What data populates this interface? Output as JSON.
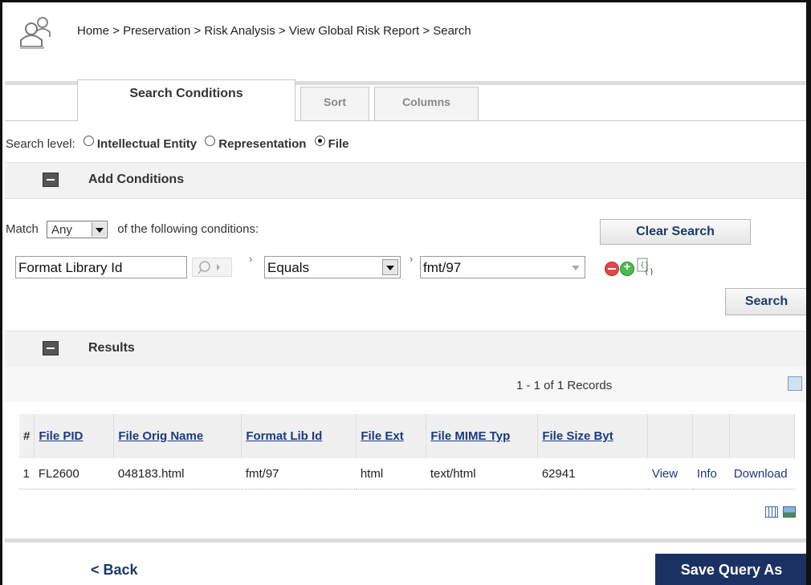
{
  "header": {
    "breadcrumb": "Home > Preservation > Risk Analysis > View Global Risk Report > Search"
  },
  "tabs": [
    {
      "label": "Search Conditions",
      "active": true
    },
    {
      "label": "Sort",
      "active": false
    },
    {
      "label": "Columns",
      "active": false
    }
  ],
  "search_level": {
    "label": "Search level:",
    "options": [
      "Intellectual Entity",
      "Representation",
      "File"
    ],
    "selected": "File"
  },
  "add_conditions": {
    "title": "Add Conditions"
  },
  "match": {
    "prefix": "Match",
    "value": "Any",
    "suffix": "of the following conditions:",
    "clear_label": "Clear Search"
  },
  "condition": {
    "field": "Format Library Id",
    "operator": "Equals",
    "value": "fmt/97"
  },
  "search_label": "Search",
  "results": {
    "title": "Results",
    "pager": "1 - 1 of 1 Records",
    "columns": [
      "#",
      "File PID",
      "File Orig Name",
      "Format Lib Id",
      "File Ext",
      "File MIME Typ",
      "File Size Byt",
      "",
      "",
      ""
    ],
    "rows": [
      [
        "1",
        "FL2600",
        "048183.html",
        "fmt/97",
        "html",
        "text/html",
        "62941",
        "View",
        "Info",
        "Download"
      ]
    ]
  },
  "footer": {
    "back_label": "< Back",
    "save_label": "Save Query As"
  },
  "colors": {
    "primary_button": "#1c3163",
    "link": "#1a3a80"
  }
}
